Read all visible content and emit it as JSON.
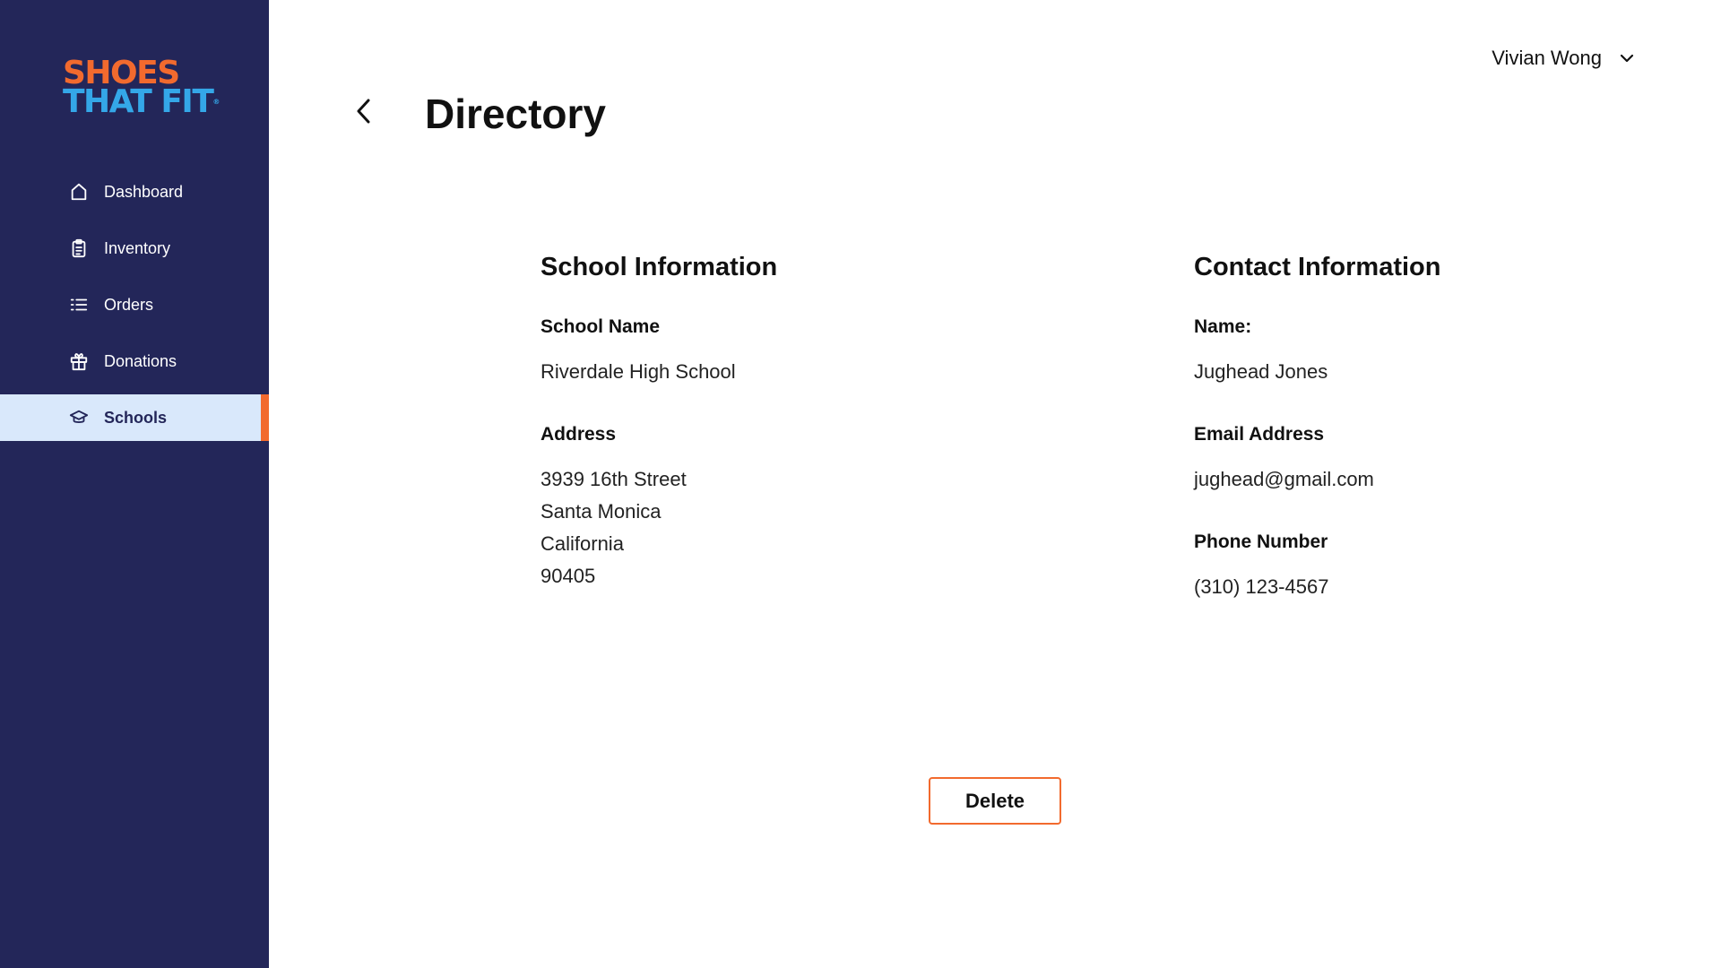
{
  "logo": {
    "line1": "SHOES",
    "line2": "THAT FIT",
    "mark": "®"
  },
  "sidebar": {
    "items": [
      {
        "label": "Dashboard",
        "icon": "home-icon"
      },
      {
        "label": "Inventory",
        "icon": "clipboard-icon"
      },
      {
        "label": "Orders",
        "icon": "list-icon"
      },
      {
        "label": "Donations",
        "icon": "gift-icon"
      },
      {
        "label": "Schools",
        "icon": "graduation-cap-icon",
        "active": true
      }
    ]
  },
  "header": {
    "title": "Directory",
    "user": "Vivian Wong"
  },
  "school_info": {
    "title": "School Information",
    "name_label": "School Name",
    "name_value": "Riverdale High School",
    "address_label": "Address",
    "address_lines": [
      "3939 16th Street",
      "Santa Monica",
      "California",
      "90405"
    ]
  },
  "contact_info": {
    "title": "Contact Information",
    "name_label": "Name:",
    "name_value": "Jughead Jones",
    "email_label": "Email Address",
    "email_value": "jughead@gmail.com",
    "phone_label": "Phone Number",
    "phone_value": "(310) 123-4567"
  },
  "actions": {
    "delete_label": "Delete"
  },
  "colors": {
    "sidebar_bg": "#232659",
    "active_bg": "#D9E8FB",
    "accent": "#F26A2E",
    "logo_blue": "#34A7E8"
  }
}
